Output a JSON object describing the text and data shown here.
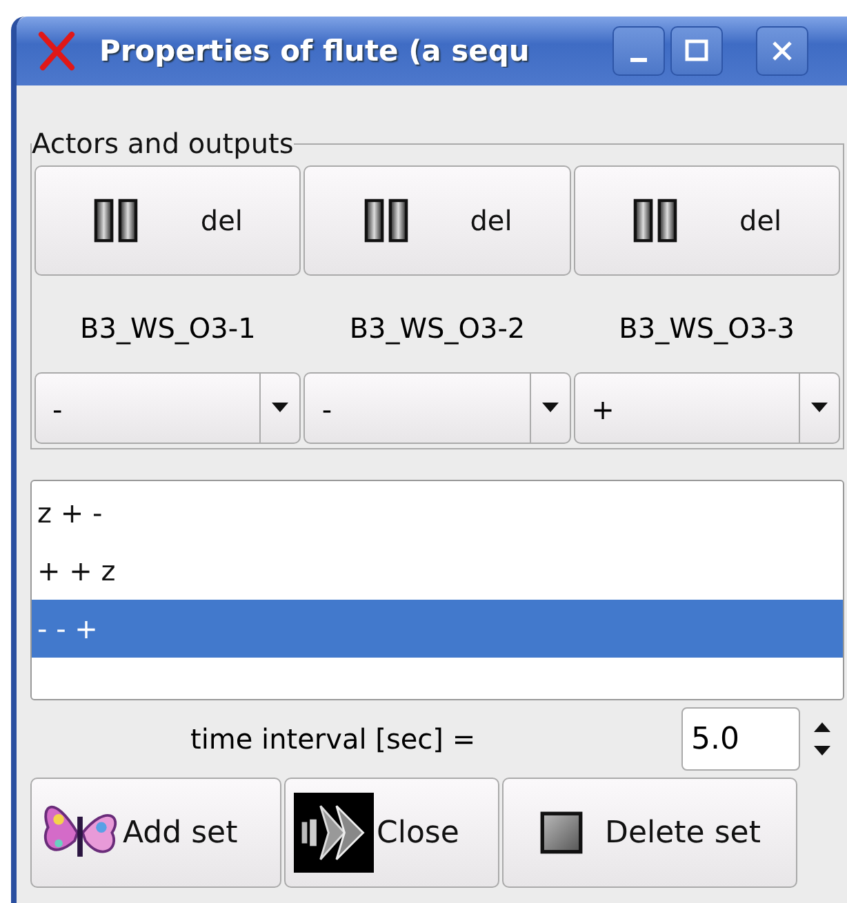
{
  "window": {
    "title": "Properties of flute (a sequ"
  },
  "group": {
    "title": "Actors and outputs"
  },
  "actors": [
    {
      "button": "del",
      "name": "B3_WS_O3-1",
      "value": "-"
    },
    {
      "button": "del",
      "name": "B3_WS_O3-2",
      "value": "-"
    },
    {
      "button": "del",
      "name": "B3_WS_O3-3",
      "value": "+"
    }
  ],
  "sets": [
    {
      "label": "z + -",
      "selected": false
    },
    {
      "label": "+ + z",
      "selected": false
    },
    {
      "label": "- - +",
      "selected": true
    }
  ],
  "interval": {
    "label": "time interval [sec] =",
    "value": "5.0"
  },
  "buttons": [
    {
      "kind": "add",
      "label": "Add set"
    },
    {
      "kind": "close",
      "label": "Close"
    },
    {
      "kind": "delete",
      "label": "Delete set"
    }
  ]
}
